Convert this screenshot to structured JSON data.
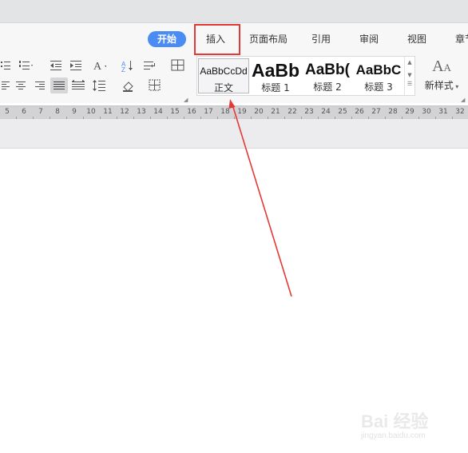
{
  "ribbon": {
    "tabs": [
      {
        "label": "开始",
        "active": true
      },
      {
        "label": "插入"
      },
      {
        "label": "页面布局"
      },
      {
        "label": "引用"
      },
      {
        "label": "审阅"
      },
      {
        "label": "视图"
      },
      {
        "label": "章节"
      }
    ],
    "style_gallery": [
      {
        "preview": "AaBbCcDd",
        "label": "正文"
      },
      {
        "preview": "AaBb",
        "label": "标题 1"
      },
      {
        "preview": "AaBb(",
        "label": "标题 2"
      },
      {
        "preview": "AaBbC",
        "label": "标题 3"
      }
    ],
    "new_style_label": "新样式",
    "accent_color": "#4b8bf4"
  },
  "ruler": {
    "numbers": [
      "5",
      "6",
      "7",
      "8",
      "9",
      "10",
      "11",
      "12",
      "13",
      "14",
      "15",
      "16",
      "17",
      "18",
      "19",
      "20",
      "21",
      "22",
      "23",
      "24",
      "25",
      "26",
      "27",
      "28",
      "29",
      "30",
      "31",
      "32"
    ]
  },
  "annotation": {
    "highlight_color": "#e53935"
  },
  "watermark": {
    "brand": "Bai 经验",
    "url": "jingyan.baidu.com"
  }
}
